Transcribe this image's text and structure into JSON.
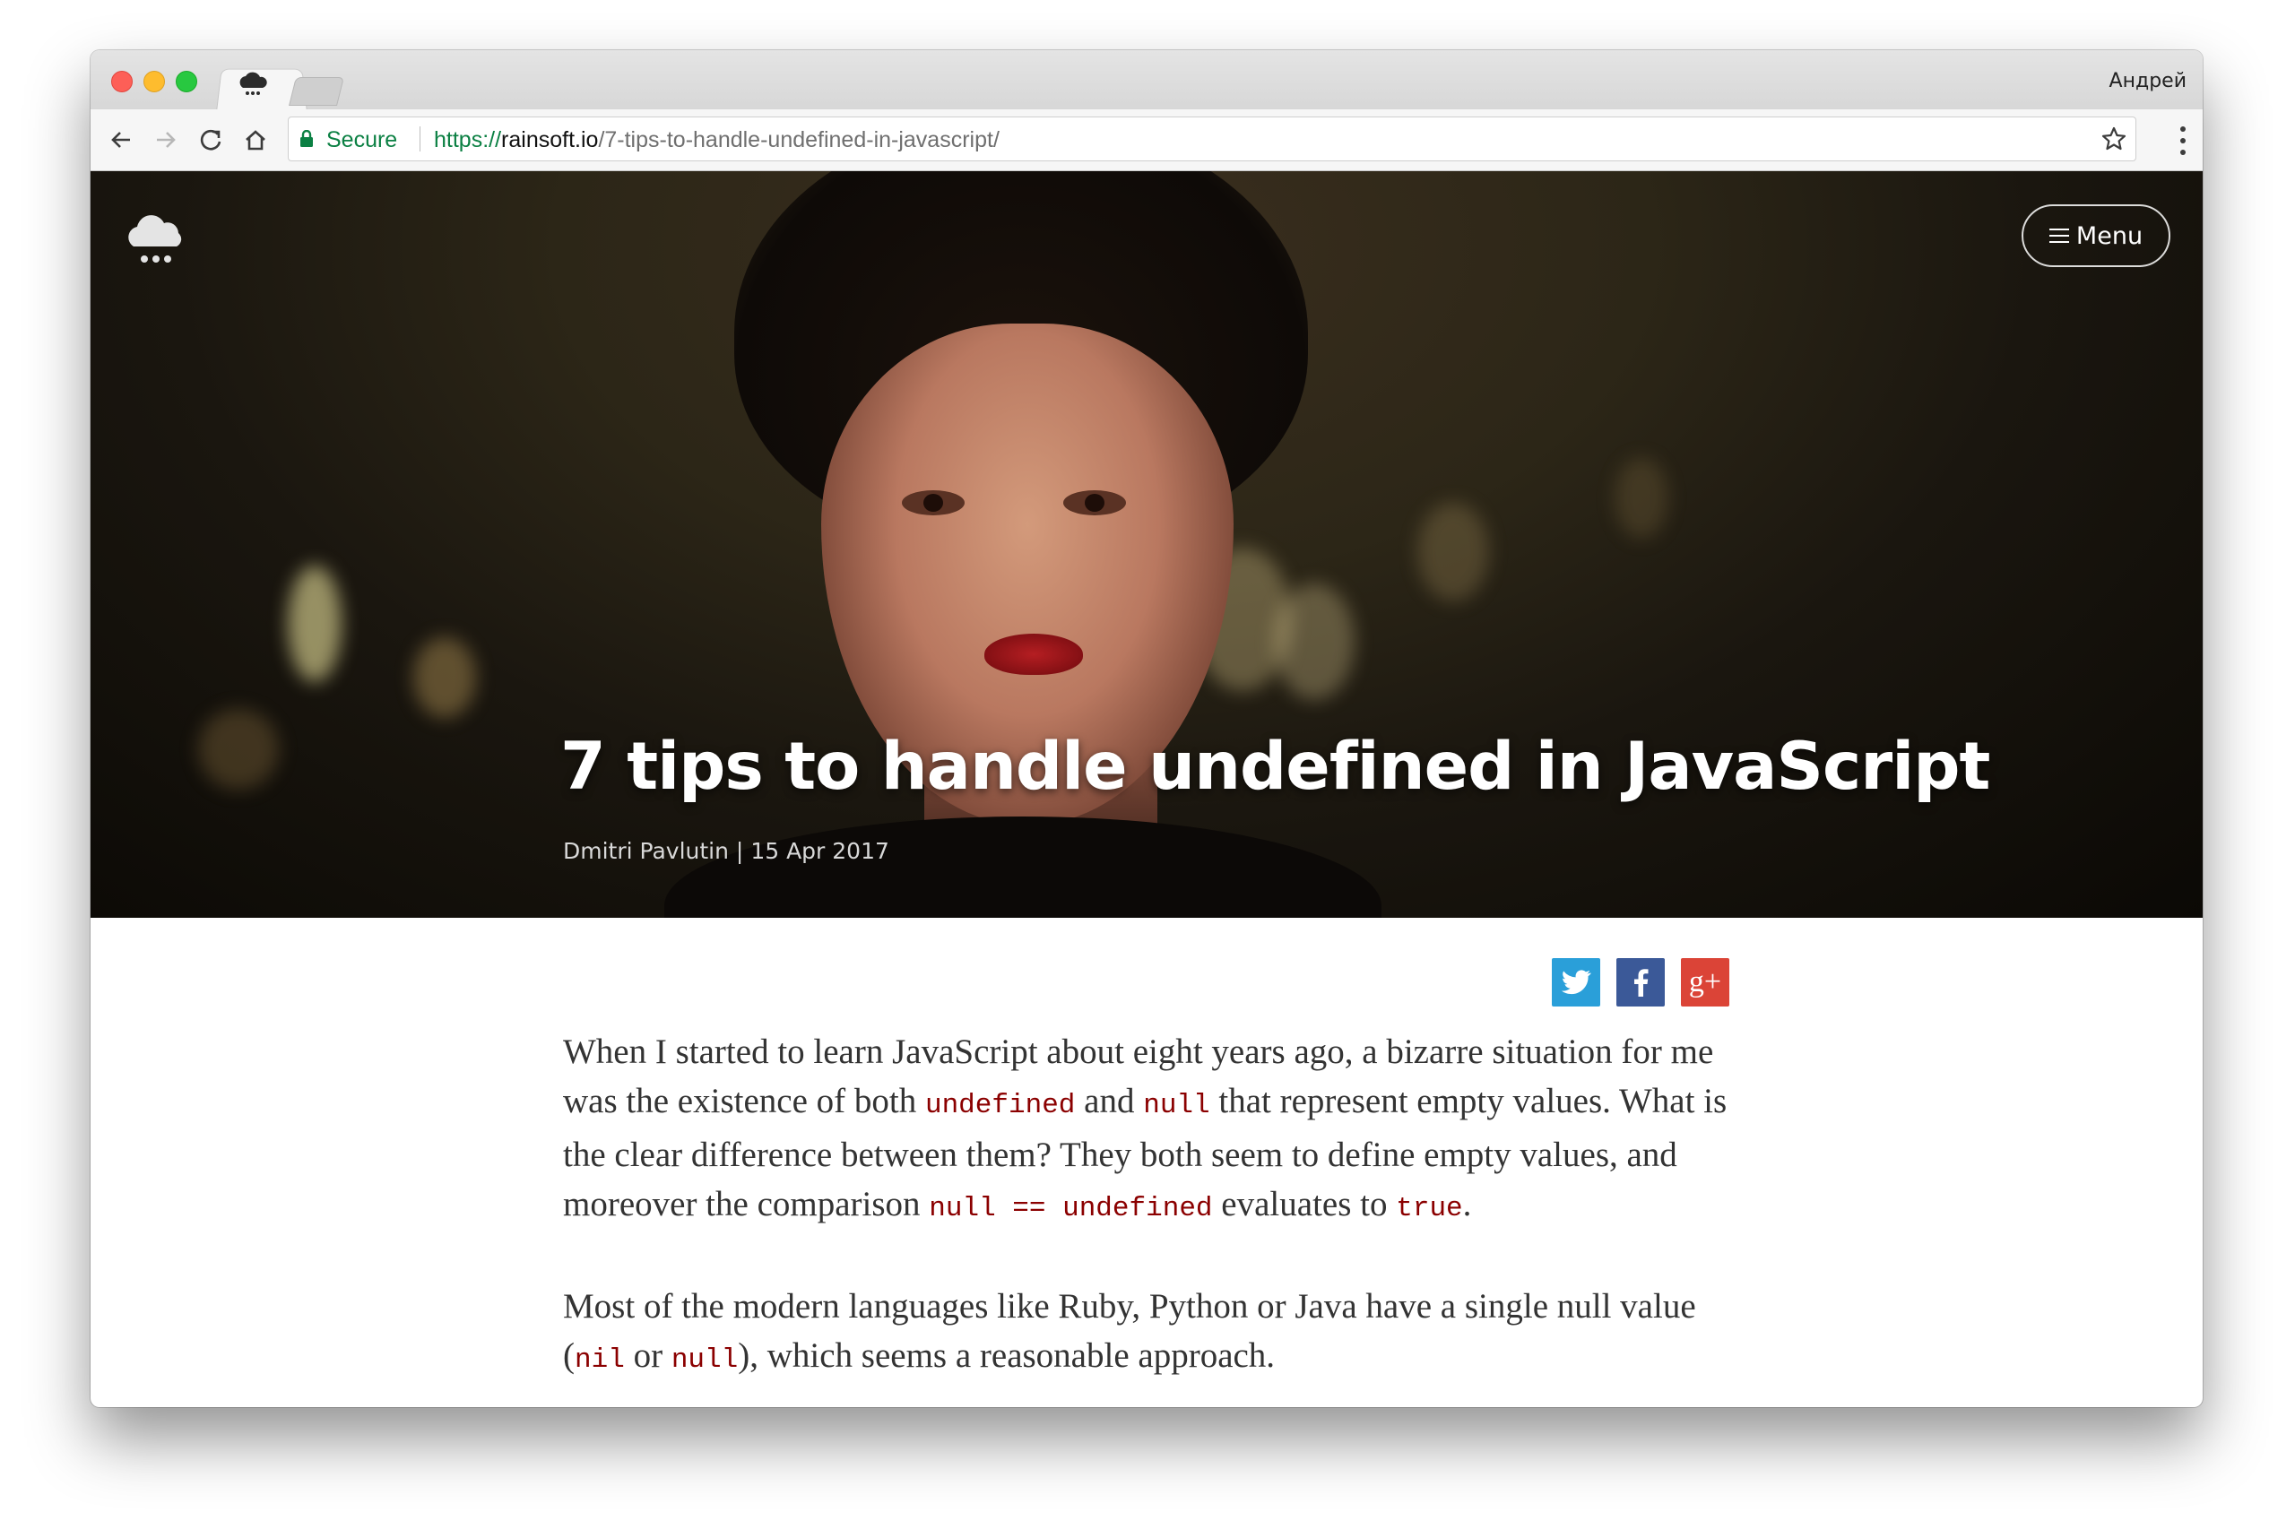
{
  "browser": {
    "profile_name": "Андрей",
    "tab_title": "",
    "secure_label": "Secure",
    "url_scheme": "https://",
    "url_host": "rainsoft.io",
    "url_path": "/7-tips-to-handle-undefined-in-javascript/"
  },
  "header": {
    "menu_label": "Menu"
  },
  "article": {
    "title": "7 tips to handle undefined in JavaScript",
    "author": "Dmitri Pavlutin",
    "byline_separator": " | ",
    "date": "15 Apr 2017"
  },
  "share": {
    "twitter": "twitter-icon",
    "facebook": "facebook-icon",
    "google_plus": "google-plus-icon",
    "google_plus_glyph": "g+"
  },
  "body": {
    "p1": {
      "t1": "When I started to learn JavaScript about eight years ago, a bizarre situation for me was the existence of both ",
      "c1": "undefined",
      "t2": " and ",
      "c2": "null",
      "t3": " that represent empty values. What is the clear difference between them? They both seem to define empty values, and moreover the comparison ",
      "c3": "null == undefined",
      "t4": " evaluates to ",
      "c4": "true",
      "t5": "."
    },
    "p2": {
      "t1": "Most of the modern languages like Ruby, Python or Java have a single null value (",
      "c1": "nil",
      "t2": " or ",
      "c2": "null",
      "t3": "), which seems a reasonable approach."
    }
  },
  "colors": {
    "secure_green": "#0b8043",
    "code_red": "#8b0000",
    "twitter": "#2a9fd9",
    "facebook": "#3b5998",
    "google_plus": "#db4437"
  }
}
